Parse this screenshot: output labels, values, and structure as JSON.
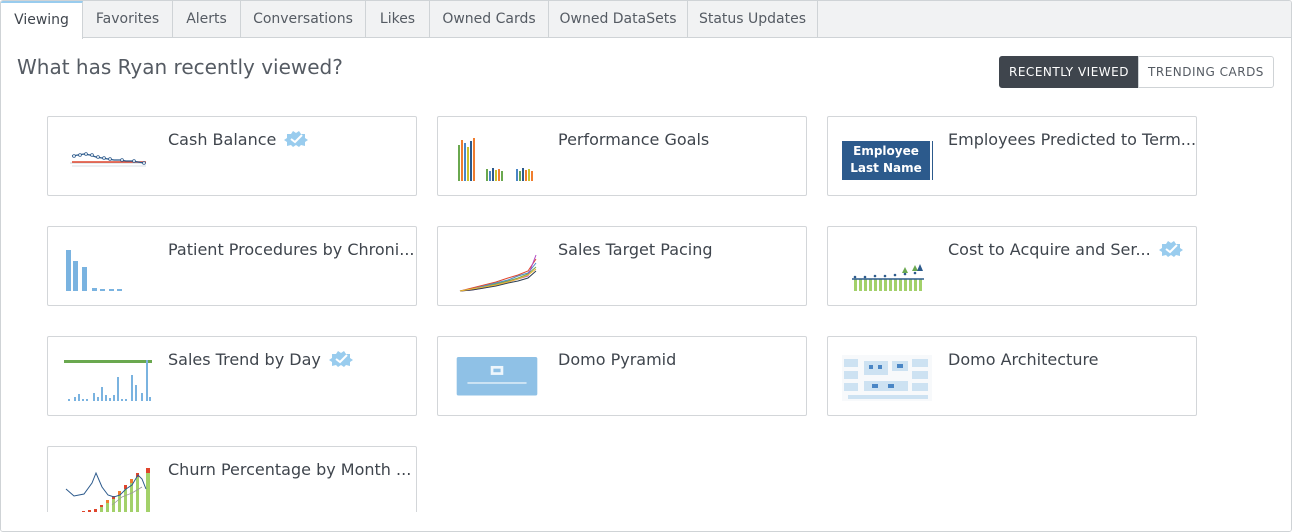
{
  "tabs": [
    {
      "label": "Viewing",
      "active": true
    },
    {
      "label": "Favorites",
      "active": false
    },
    {
      "label": "Alerts",
      "active": false
    },
    {
      "label": "Conversations",
      "active": false
    },
    {
      "label": "Likes",
      "active": false
    },
    {
      "label": "Owned Cards",
      "active": false
    },
    {
      "label": "Owned DataSets",
      "active": false
    },
    {
      "label": "Status Updates",
      "active": false
    }
  ],
  "header": {
    "title": "What has Ryan recently viewed?"
  },
  "toggle": {
    "recent_label": "RECENTLY VIEWED",
    "trending_label": "TRENDING CARDS",
    "selected": "RECENTLY VIEWED"
  },
  "cards": [
    {
      "name": "Cash Balance",
      "certified": true,
      "thumbnail": "line-chart"
    },
    {
      "name": "Performance Goals",
      "certified": false,
      "thumbnail": "grouped-bar-chart"
    },
    {
      "name": "Employees Predicted to Term...",
      "certified": false,
      "thumbnail": "table-header",
      "thumbnail_text": [
        "Employee",
        "Last Name"
      ]
    },
    {
      "name": "Patient Procedures by Chroni...",
      "certified": false,
      "thumbnail": "bar-chart"
    },
    {
      "name": "Sales Target Pacing",
      "certified": false,
      "thumbnail": "multi-line-chart"
    },
    {
      "name": "Cost to Acquire and Ser...",
      "certified": true,
      "thumbnail": "bar-line-chart"
    },
    {
      "name": "Sales Trend by Day",
      "certified": true,
      "thumbnail": "bar-target-chart"
    },
    {
      "name": "Domo Pyramid",
      "certified": false,
      "thumbnail": "image"
    },
    {
      "name": "Domo Architecture",
      "certified": false,
      "thumbnail": "diagram"
    },
    {
      "name": "Churn Percentage by Month ...",
      "certified": false,
      "thumbnail": "stacked-bar-line-chart"
    }
  ],
  "colors": {
    "tab_bar": "#f1f2f3",
    "active_dark": "#3f454d",
    "certified_badge": "#99ccee",
    "accent_blue": "#2c5a8c"
  }
}
